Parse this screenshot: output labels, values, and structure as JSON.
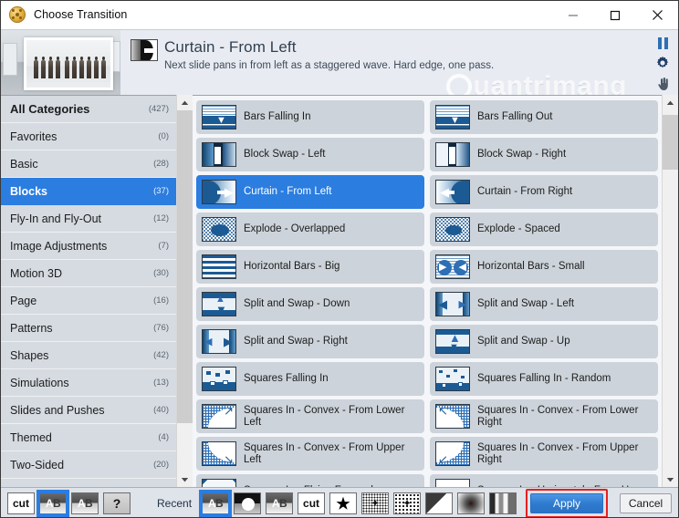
{
  "window": {
    "title": "Choose Transition",
    "app_icon": "film-reel-icon",
    "controls": {
      "minimize": "minimize-icon",
      "maximize": "maximize-icon",
      "close": "close-icon"
    }
  },
  "header": {
    "preview_alt": "slide-preview-thumbnail",
    "transition_icon": "curtain-from-left-icon",
    "title": "Curtain - From Left",
    "description": "Next slide pans in from left as a staggered wave. Hard edge, one pass.",
    "watermark": "uantrimang",
    "tools": [
      {
        "name": "pause-icon",
        "label": "Pause"
      },
      {
        "name": "gear-icon",
        "label": "Settings"
      },
      {
        "name": "hand-cursor-icon",
        "label": "Pan"
      }
    ]
  },
  "sidebar": {
    "items": [
      {
        "label": "All Categories",
        "count": "(427)",
        "selected": false,
        "bold": true
      },
      {
        "label": "Favorites",
        "count": "(0)",
        "selected": false
      },
      {
        "label": "Basic",
        "count": "(28)",
        "selected": false
      },
      {
        "label": "Blocks",
        "count": "(37)",
        "selected": true
      },
      {
        "label": "Fly-In and Fly-Out",
        "count": "(12)",
        "selected": false
      },
      {
        "label": "Image Adjustments",
        "count": "(7)",
        "selected": false
      },
      {
        "label": "Motion 3D",
        "count": "(30)",
        "selected": false
      },
      {
        "label": "Page",
        "count": "(16)",
        "selected": false
      },
      {
        "label": "Patterns",
        "count": "(76)",
        "selected": false
      },
      {
        "label": "Shapes",
        "count": "(42)",
        "selected": false
      },
      {
        "label": "Simulations",
        "count": "(13)",
        "selected": false
      },
      {
        "label": "Slides and Pushes",
        "count": "(40)",
        "selected": false
      },
      {
        "label": "Themed",
        "count": "(4)",
        "selected": false
      },
      {
        "label": "Two-Sided",
        "count": "(20)",
        "selected": false
      }
    ]
  },
  "transitions": [
    {
      "label": "Bars Falling In",
      "art": "bars-in",
      "selected": false
    },
    {
      "label": "Bars Falling Out",
      "art": "bars-out",
      "selected": false
    },
    {
      "label": "Block Swap - Left",
      "art": "block-swap-left",
      "selected": false
    },
    {
      "label": "Block Swap - Right",
      "art": "block-swap-right",
      "selected": false
    },
    {
      "label": "Curtain - From Left",
      "art": "curtain-left",
      "selected": true
    },
    {
      "label": "Curtain - From Right",
      "art": "curtain-right",
      "selected": false
    },
    {
      "label": "Explode - Overlapped",
      "art": "explode-overlapped",
      "selected": false
    },
    {
      "label": "Explode - Spaced",
      "art": "explode-spaced",
      "selected": false
    },
    {
      "label": "Horizontal Bars - Big",
      "art": "hbars-big",
      "selected": false
    },
    {
      "label": "Horizontal Bars - Small",
      "art": "hbars-small",
      "selected": false
    },
    {
      "label": "Split and Swap - Down",
      "art": "swap-down",
      "selected": false
    },
    {
      "label": "Split and Swap - Left",
      "art": "swap-left",
      "selected": false
    },
    {
      "label": "Split and Swap - Right",
      "art": "swap-right",
      "selected": false
    },
    {
      "label": "Split and Swap - Up",
      "art": "swap-up",
      "selected": false
    },
    {
      "label": "Squares Falling In",
      "art": "squares-falling",
      "selected": false
    },
    {
      "label": "Squares Falling In - Random",
      "art": "squares-random",
      "selected": false
    },
    {
      "label": "Squares In - Convex - From Lower Left",
      "art": "convex-lower-left",
      "selected": false
    },
    {
      "label": "Squares In - Convex - From Lower Right",
      "art": "convex-lower-right",
      "selected": false
    },
    {
      "label": "Squares In - Convex - From Upper Left",
      "art": "convex-upper-left",
      "selected": false
    },
    {
      "label": "Squares In - Convex - From Upper Right",
      "art": "convex-upper-right",
      "selected": false
    },
    {
      "label": "Squares In - Flying Forward",
      "art": "squares-flying",
      "selected": false
    },
    {
      "label": "Squares In - Horizontal - From Upper",
      "art": "squares-horizontal",
      "selected": false
    }
  ],
  "bottom": {
    "left_thumbs": [
      {
        "name": "cut-thumb",
        "art": "cut",
        "selected": false
      },
      {
        "name": "ab-thumb",
        "art": "ab",
        "selected": true
      },
      {
        "name": "ab-gray-thumb",
        "art": "ab",
        "selected": false
      },
      {
        "name": "question-thumb",
        "art": "question",
        "selected": false
      }
    ],
    "recent_label": "Recent",
    "recent_thumbs": [
      {
        "name": "recent-ab-thumb",
        "art": "ab",
        "selected": true
      },
      {
        "name": "recent-circle-thumb",
        "art": "circle",
        "selected": false
      },
      {
        "name": "recent-ab2-thumb",
        "art": "ab",
        "selected": false
      },
      {
        "name": "recent-cut-thumb",
        "art": "cut",
        "selected": false
      },
      {
        "name": "recent-star-thumb",
        "art": "star",
        "selected": false
      },
      {
        "name": "recent-noise1-thumb",
        "art": "noise1",
        "selected": false
      },
      {
        "name": "recent-noise2-thumb",
        "art": "noise2",
        "selected": false
      },
      {
        "name": "recent-corner-thumb",
        "art": "corner",
        "selected": false
      },
      {
        "name": "recent-radial-thumb",
        "art": "radial",
        "selected": false
      },
      {
        "name": "recent-stripes-thumb",
        "art": "stripes",
        "selected": false
      }
    ],
    "apply_label": "Apply",
    "cancel_label": "Cancel",
    "highlight_color": "#e62020",
    "accent_color": "#2b7de0"
  }
}
